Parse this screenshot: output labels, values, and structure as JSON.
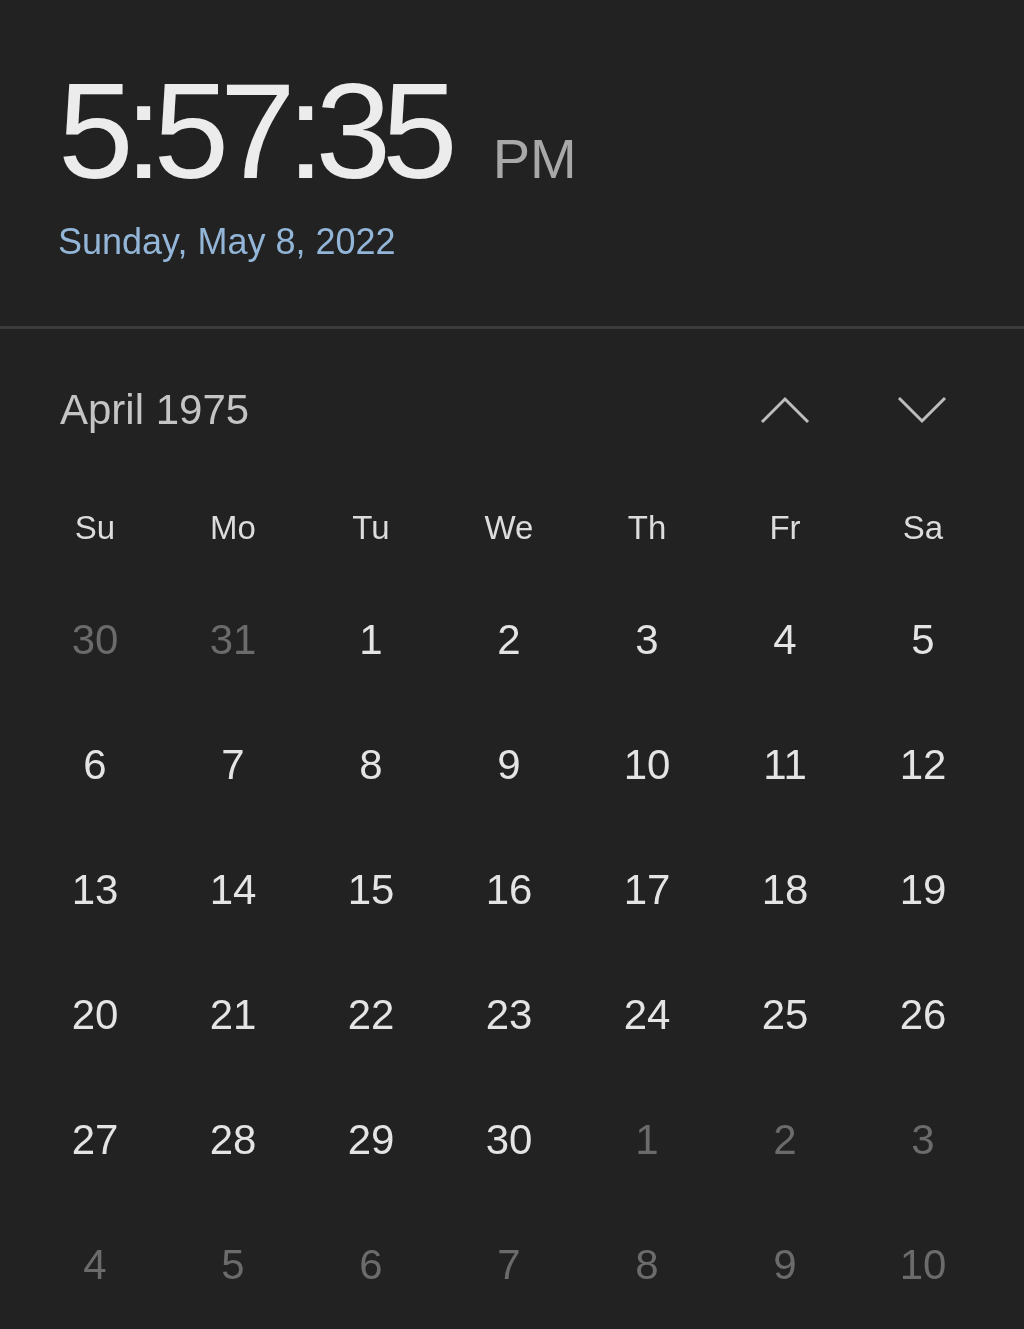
{
  "clock": {
    "time": "5:57:35",
    "period": "PM",
    "date": "Sunday, May 8, 2022"
  },
  "calendar": {
    "month": "April 1975",
    "weekdays": [
      "Su",
      "Mo",
      "Tu",
      "We",
      "Th",
      "Fr",
      "Sa"
    ],
    "days": [
      {
        "label": "30",
        "in_month": false
      },
      {
        "label": "31",
        "in_month": false
      },
      {
        "label": "1",
        "in_month": true
      },
      {
        "label": "2",
        "in_month": true
      },
      {
        "label": "3",
        "in_month": true
      },
      {
        "label": "4",
        "in_month": true
      },
      {
        "label": "5",
        "in_month": true
      },
      {
        "label": "6",
        "in_month": true
      },
      {
        "label": "7",
        "in_month": true
      },
      {
        "label": "8",
        "in_month": true
      },
      {
        "label": "9",
        "in_month": true
      },
      {
        "label": "10",
        "in_month": true
      },
      {
        "label": "11",
        "in_month": true
      },
      {
        "label": "12",
        "in_month": true
      },
      {
        "label": "13",
        "in_month": true
      },
      {
        "label": "14",
        "in_month": true
      },
      {
        "label": "15",
        "in_month": true
      },
      {
        "label": "16",
        "in_month": true
      },
      {
        "label": "17",
        "in_month": true
      },
      {
        "label": "18",
        "in_month": true
      },
      {
        "label": "19",
        "in_month": true
      },
      {
        "label": "20",
        "in_month": true
      },
      {
        "label": "21",
        "in_month": true
      },
      {
        "label": "22",
        "in_month": true
      },
      {
        "label": "23",
        "in_month": true
      },
      {
        "label": "24",
        "in_month": true
      },
      {
        "label": "25",
        "in_month": true
      },
      {
        "label": "26",
        "in_month": true
      },
      {
        "label": "27",
        "in_month": true
      },
      {
        "label": "28",
        "in_month": true
      },
      {
        "label": "29",
        "in_month": true
      },
      {
        "label": "30",
        "in_month": true
      },
      {
        "label": "1",
        "in_month": false
      },
      {
        "label": "2",
        "in_month": false
      },
      {
        "label": "3",
        "in_month": false
      },
      {
        "label": "4",
        "in_month": false
      },
      {
        "label": "5",
        "in_month": false
      },
      {
        "label": "6",
        "in_month": false
      },
      {
        "label": "7",
        "in_month": false
      },
      {
        "label": "8",
        "in_month": false
      },
      {
        "label": "9",
        "in_month": false
      },
      {
        "label": "10",
        "in_month": false
      }
    ]
  }
}
